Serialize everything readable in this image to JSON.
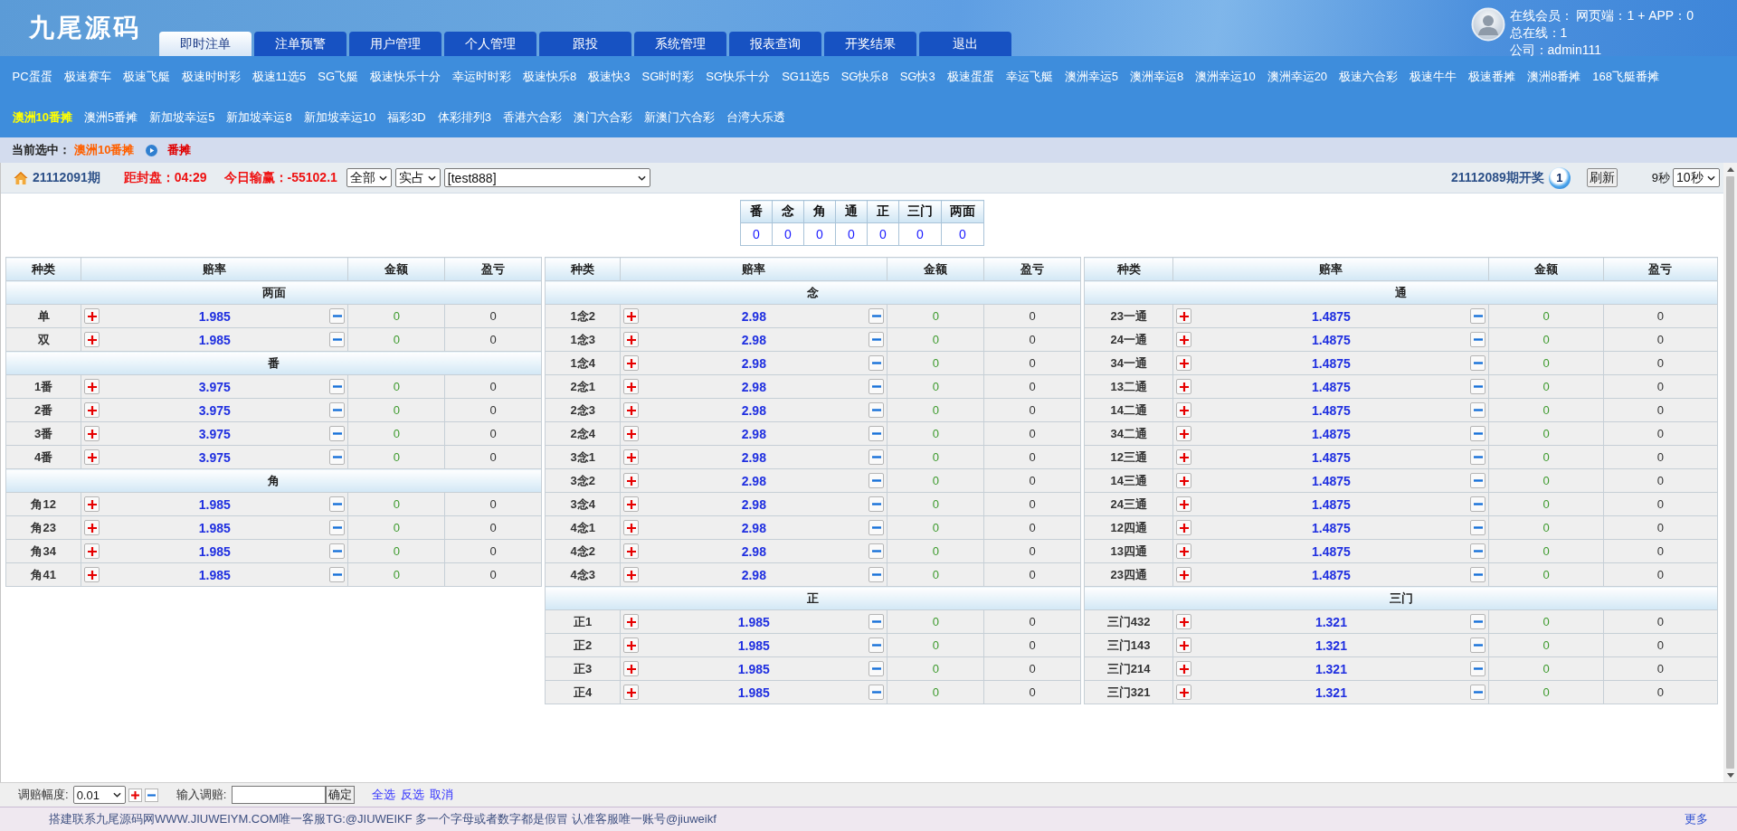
{
  "header": {
    "logo": "九尾源码",
    "tabs": [
      {
        "label": "即时注单",
        "selected": true
      },
      {
        "label": "注单预警",
        "selected": false
      },
      {
        "label": "用户管理",
        "selected": false
      },
      {
        "label": "个人管理",
        "selected": false
      },
      {
        "label": "跟投",
        "selected": false
      },
      {
        "label": "系统管理",
        "selected": false
      },
      {
        "label": "报表查询",
        "selected": false
      },
      {
        "label": "开奖结果",
        "selected": false
      },
      {
        "label": "退出",
        "selected": false
      }
    ],
    "online": [
      "在线会员： 网页端：1 + APP：0",
      "总在线：1",
      "公司：admin111"
    ]
  },
  "game_menu": [
    {
      "items": [
        {
          "label": "PC蛋蛋",
          "selected": false
        },
        {
          "label": "极速赛车",
          "selected": false
        },
        {
          "label": "极速飞艇",
          "selected": false
        },
        {
          "label": "极速时时彩",
          "selected": false
        },
        {
          "label": "极速11选5",
          "selected": false
        },
        {
          "label": "SG飞艇",
          "selected": false
        },
        {
          "label": "极速快乐十分",
          "selected": false
        },
        {
          "label": "幸运时时彩",
          "selected": false
        },
        {
          "label": "极速快乐8",
          "selected": false
        },
        {
          "label": "极速快3",
          "selected": false
        },
        {
          "label": "SG时时彩",
          "selected": false
        },
        {
          "label": "SG快乐十分",
          "selected": false
        },
        {
          "label": "SG11选5",
          "selected": false
        },
        {
          "label": "SG快乐8",
          "selected": false
        },
        {
          "label": "SG快3",
          "selected": false
        },
        {
          "label": "极速蛋蛋",
          "selected": false
        },
        {
          "label": "幸运飞艇",
          "selected": false
        },
        {
          "label": "澳洲幸运5",
          "selected": false
        },
        {
          "label": "澳洲幸运8",
          "selected": false
        },
        {
          "label": "澳洲幸运10",
          "selected": false
        },
        {
          "label": "澳洲幸运20",
          "selected": false
        },
        {
          "label": "极速六合彩",
          "selected": false
        },
        {
          "label": "极速牛牛",
          "selected": false
        },
        {
          "label": "极速番摊",
          "selected": false
        },
        {
          "label": "澳洲8番摊",
          "selected": false
        },
        {
          "label": "168飞艇番摊",
          "selected": false
        }
      ]
    },
    {
      "items": [
        {
          "label": "澳洲10番摊",
          "selected": true
        },
        {
          "label": "澳洲5番摊",
          "selected": false
        },
        {
          "label": "新加坡幸运5",
          "selected": false
        },
        {
          "label": "新加坡幸运8",
          "selected": false
        },
        {
          "label": "新加坡幸运10",
          "selected": false
        },
        {
          "label": "福彩3D",
          "selected": false
        },
        {
          "label": "体彩排列3",
          "selected": false
        },
        {
          "label": "香港六合彩",
          "selected": false
        },
        {
          "label": "澳门六合彩",
          "selected": false
        },
        {
          "label": "新澳门六合彩",
          "selected": false
        },
        {
          "label": "台湾大乐透",
          "selected": false
        }
      ]
    }
  ],
  "current": {
    "label": "当前选中：",
    "game": "澳洲10番摊",
    "play": "番摊"
  },
  "info_bar": {
    "period": "21112091期",
    "countdown": "距封盘：04:29",
    "today_result": "今日输赢：-55102.1",
    "filters": [
      "全部",
      "实占",
      "[test888]"
    ],
    "draw": {
      "label": "21112089期开奖",
      "ball": "1"
    },
    "refresh_button": "刷新",
    "seconds_left": "9秒",
    "interval": "10秒"
  },
  "summary": {
    "columns": [
      "番",
      "念",
      "角",
      "通",
      "正",
      "三门",
      "两面"
    ],
    "values": [
      "0",
      "0",
      "0",
      "0",
      "0",
      "0",
      "0"
    ]
  },
  "tables": [
    {
      "columns": [
        "种类",
        "赔率",
        "金额",
        "盈亏"
      ],
      "sections": [
        {
          "title": "两面",
          "rows": [
            {
              "name": "单",
              "odds": "1.985",
              "amount": "0",
              "profit": "0"
            },
            {
              "name": "双",
              "odds": "1.985",
              "amount": "0",
              "profit": "0"
            }
          ]
        },
        {
          "title": "番",
          "rows": [
            {
              "name": "1番",
              "odds": "3.975",
              "amount": "0",
              "profit": "0"
            },
            {
              "name": "2番",
              "odds": "3.975",
              "amount": "0",
              "profit": "0"
            },
            {
              "name": "3番",
              "odds": "3.975",
              "amount": "0",
              "profit": "0"
            },
            {
              "name": "4番",
              "odds": "3.975",
              "amount": "0",
              "profit": "0"
            }
          ]
        },
        {
          "title": "角",
          "rows": [
            {
              "name": "角12",
              "odds": "1.985",
              "amount": "0",
              "profit": "0"
            },
            {
              "name": "角23",
              "odds": "1.985",
              "amount": "0",
              "profit": "0"
            },
            {
              "name": "角34",
              "odds": "1.985",
              "amount": "0",
              "profit": "0"
            },
            {
              "name": "角41",
              "odds": "1.985",
              "amount": "0",
              "profit": "0"
            }
          ]
        }
      ]
    },
    {
      "columns": [
        "种类",
        "赔率",
        "金额",
        "盈亏"
      ],
      "sections": [
        {
          "title": "念",
          "rows": [
            {
              "name": "1念2",
              "odds": "2.98",
              "amount": "0",
              "profit": "0"
            },
            {
              "name": "1念3",
              "odds": "2.98",
              "amount": "0",
              "profit": "0"
            },
            {
              "name": "1念4",
              "odds": "2.98",
              "amount": "0",
              "profit": "0"
            },
            {
              "name": "2念1",
              "odds": "2.98",
              "amount": "0",
              "profit": "0"
            },
            {
              "name": "2念3",
              "odds": "2.98",
              "amount": "0",
              "profit": "0"
            },
            {
              "name": "2念4",
              "odds": "2.98",
              "amount": "0",
              "profit": "0"
            },
            {
              "name": "3念1",
              "odds": "2.98",
              "amount": "0",
              "profit": "0"
            },
            {
              "name": "3念2",
              "odds": "2.98",
              "amount": "0",
              "profit": "0"
            },
            {
              "name": "3念4",
              "odds": "2.98",
              "amount": "0",
              "profit": "0"
            },
            {
              "name": "4念1",
              "odds": "2.98",
              "amount": "0",
              "profit": "0"
            },
            {
              "name": "4念2",
              "odds": "2.98",
              "amount": "0",
              "profit": "0"
            },
            {
              "name": "4念3",
              "odds": "2.98",
              "amount": "0",
              "profit": "0"
            }
          ]
        },
        {
          "title": "正",
          "rows": [
            {
              "name": "正1",
              "odds": "1.985",
              "amount": "0",
              "profit": "0"
            },
            {
              "name": "正2",
              "odds": "1.985",
              "amount": "0",
              "profit": "0"
            },
            {
              "name": "正3",
              "odds": "1.985",
              "amount": "0",
              "profit": "0"
            },
            {
              "name": "正4",
              "odds": "1.985",
              "amount": "0",
              "profit": "0"
            }
          ]
        }
      ]
    },
    {
      "columns": [
        "种类",
        "赔率",
        "金额",
        "盈亏"
      ],
      "sections": [
        {
          "title": "通",
          "rows": [
            {
              "name": "23一通",
              "odds": "1.4875",
              "amount": "0",
              "profit": "0"
            },
            {
              "name": "24一通",
              "odds": "1.4875",
              "amount": "0",
              "profit": "0"
            },
            {
              "name": "34一通",
              "odds": "1.4875",
              "amount": "0",
              "profit": "0"
            },
            {
              "name": "13二通",
              "odds": "1.4875",
              "amount": "0",
              "profit": "0"
            },
            {
              "name": "14二通",
              "odds": "1.4875",
              "amount": "0",
              "profit": "0"
            },
            {
              "name": "34二通",
              "odds": "1.4875",
              "amount": "0",
              "profit": "0"
            },
            {
              "name": "12三通",
              "odds": "1.4875",
              "amount": "0",
              "profit": "0"
            },
            {
              "name": "14三通",
              "odds": "1.4875",
              "amount": "0",
              "profit": "0"
            },
            {
              "name": "24三通",
              "odds": "1.4875",
              "amount": "0",
              "profit": "0"
            },
            {
              "name": "12四通",
              "odds": "1.4875",
              "amount": "0",
              "profit": "0"
            },
            {
              "name": "13四通",
              "odds": "1.4875",
              "amount": "0",
              "profit": "0"
            },
            {
              "name": "23四通",
              "odds": "1.4875",
              "amount": "0",
              "profit": "0"
            }
          ]
        },
        {
          "title": "三门",
          "rows": [
            {
              "name": "三门432",
              "odds": "1.321",
              "amount": "0",
              "profit": "0"
            },
            {
              "name": "三门143",
              "odds": "1.321",
              "amount": "0",
              "profit": "0"
            },
            {
              "name": "三门214",
              "odds": "1.321",
              "amount": "0",
              "profit": "0"
            },
            {
              "name": "三门321",
              "odds": "1.321",
              "amount": "0",
              "profit": "0"
            }
          ]
        }
      ]
    }
  ],
  "adjust_bar": {
    "step_label": "调赔幅度:",
    "step_value": "0.01",
    "input_label": "输入调赔:",
    "confirm_button": "确定",
    "links": [
      "全选",
      "反选",
      "取消"
    ]
  },
  "footer": {
    "notice": "搭建联系九尾源码网WWW.JIUWEIYM.COM唯一客服TG:@JIUWEIKF 多一个字母或者数字都是假冒 认准客服唯一账号@jiuweikf",
    "more": "更多"
  }
}
